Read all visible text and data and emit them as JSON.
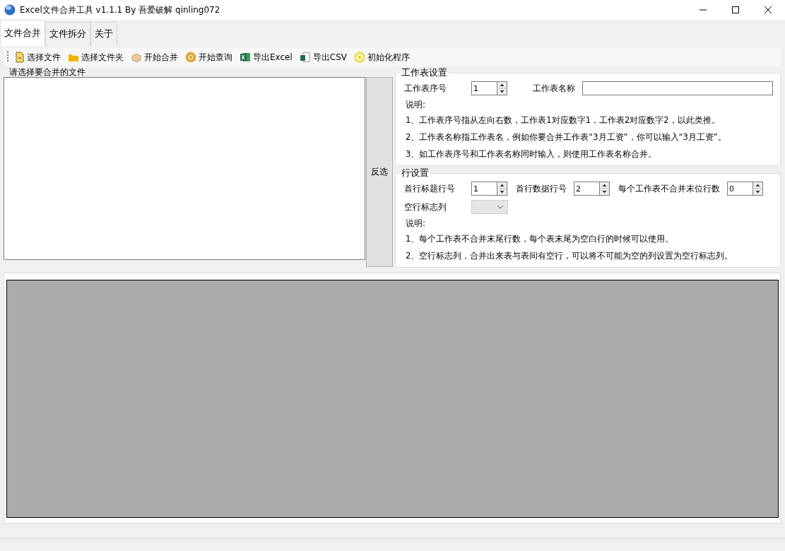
{
  "window": {
    "title": "Excel文件合并工具 v1.1.1 By 吾爱破解 qinling072"
  },
  "tabs": [
    {
      "label": "文件合并",
      "selected": true
    },
    {
      "label": "文件拆分",
      "selected": false
    },
    {
      "label": "关于",
      "selected": false
    }
  ],
  "toolbar": [
    {
      "label": "选择文件",
      "kind": "file"
    },
    {
      "label": "选择文件夹",
      "kind": "folder"
    },
    {
      "label": "开始合并",
      "kind": "box"
    },
    {
      "label": "开始查询",
      "kind": "query"
    },
    {
      "label": "导出Excel",
      "kind": "excel"
    },
    {
      "label": "导出CSV",
      "kind": "csv"
    },
    {
      "label": "初始化程序",
      "kind": "reset"
    }
  ],
  "file_list": {
    "title": "请选择要合并的文件"
  },
  "invert_button": "反选",
  "sheet_settings": {
    "title": "工作表设置",
    "index_label": "工作表序号",
    "index_value": "1",
    "name_label": "工作表名称",
    "notes_title": "说明:",
    "notes": [
      "1、工作表序号指从左向右数，工作表1对应数字1，工作表2对应数字2，以此类推。",
      "2、工作表名称指工作表名，例如你要合并工作表“3月工资”，你可以输入“3月工资”。",
      "3、如工作表序号和工作表名称同时输入，则使用工作表名称合并。"
    ]
  },
  "row_settings": {
    "title": "行设置",
    "fields": [
      {
        "label": "首行标题行号",
        "value": "1"
      },
      {
        "label": "首行数据行号",
        "value": "2"
      },
      {
        "label": "每个工作表不合并末位行数",
        "value": "0"
      }
    ],
    "blank_label": "空行标志列",
    "notes_title": "说明:",
    "notes": [
      "1、每个工作表不合并末尾行数，每个表末尾为空白行的时候可以使用。",
      "2、空行标志列，合并出来表与表间有空行，可以将不可能为空的列设置为空行标志列。"
    ]
  }
}
